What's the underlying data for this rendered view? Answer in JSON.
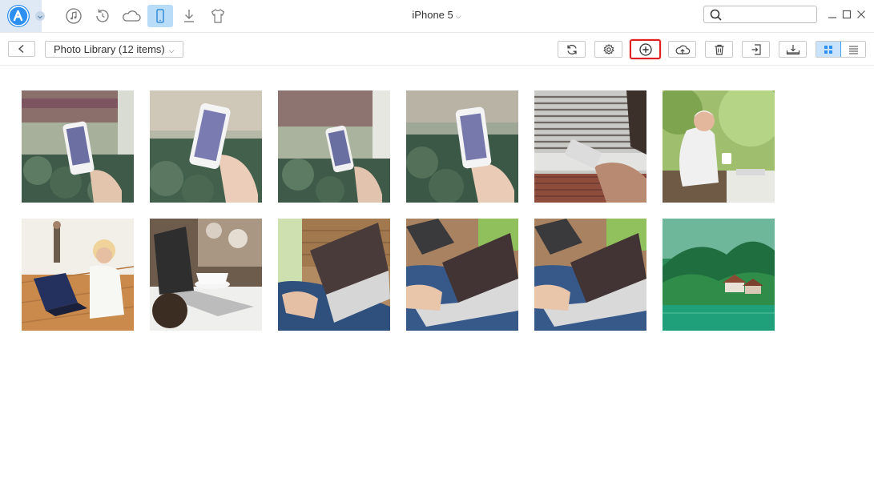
{
  "app": {
    "logo_icon": "app-logo-icon",
    "nav_icons": [
      "music-icon",
      "restore-icon",
      "cloud-icon",
      "phone-icon",
      "download-icon",
      "shirt-icon"
    ],
    "active_nav": "phone-icon",
    "accent_color": "#2d8ff0"
  },
  "header": {
    "device_name": "iPhone 5",
    "search": {
      "value": "",
      "placeholder": ""
    }
  },
  "toolbar": {
    "library_label": "Photo Library (12 items)",
    "buttons": [
      "refresh-icon",
      "settings-icon",
      "add-icon",
      "cloud-upload-icon",
      "trash-icon",
      "export-icon",
      "import-to-pc-icon"
    ],
    "highlighted_button": "add-icon",
    "highlight_color": "#e02020",
    "view_mode": "grid"
  },
  "photos": [
    "hand holding phone near plants",
    "hand holding phone near plants",
    "hand holding phone near plants",
    "hand holding phone near plants",
    "hand holding phone on wooden table",
    "elderly man reading with cup",
    "woman with laptop on floor",
    "laptop and coffee cup",
    "hands typing on laptop",
    "hands typing on laptop",
    "hands typing on laptop",
    "green valley with houses"
  ]
}
